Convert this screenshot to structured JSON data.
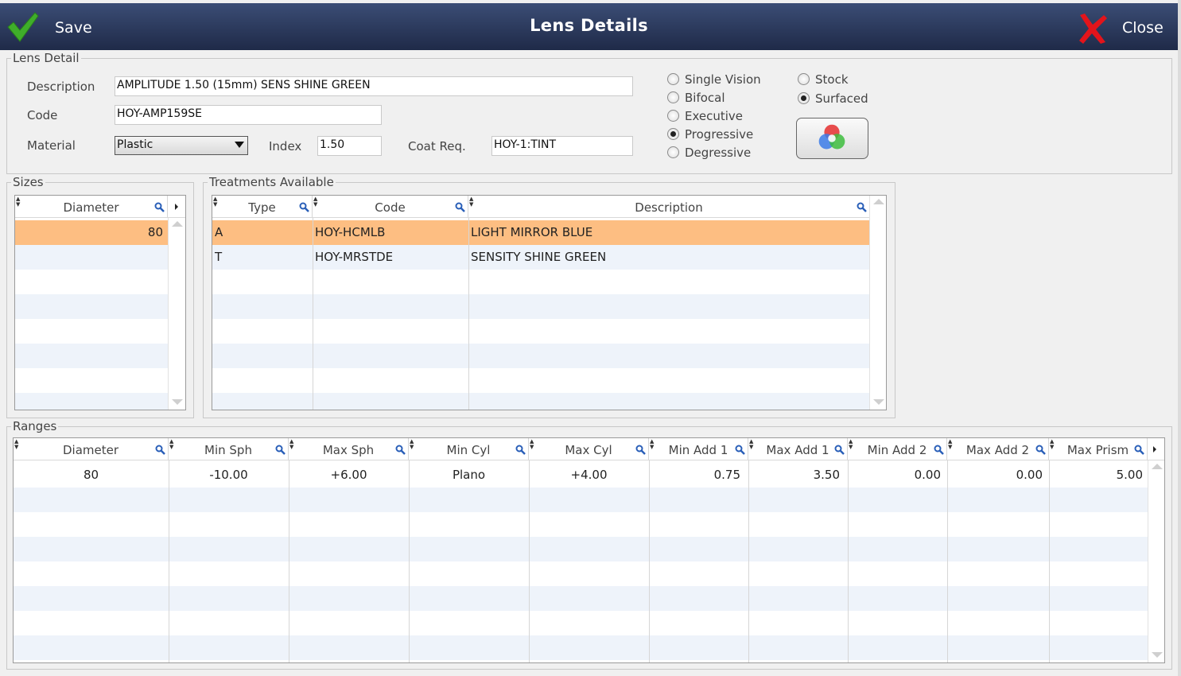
{
  "header": {
    "save_label": "Save",
    "title": "Lens Details",
    "close_label": "Close"
  },
  "lens_detail": {
    "group_title": "Lens Detail",
    "description_label": "Description",
    "description_value": "AMPLITUDE 1.50 (15mm) SENS SHINE GREEN",
    "code_label": "Code",
    "code_value": "HOY-AMP159SE",
    "material_label": "Material",
    "material_value": "Plastic",
    "index_label": "Index",
    "index_value": "1.50",
    "coat_label": "Coat Req.",
    "coat_value": "HOY-1:TINT",
    "vision_types": [
      {
        "label": "Single Vision",
        "selected": false
      },
      {
        "label": "Bifocal",
        "selected": false
      },
      {
        "label": "Executive",
        "selected": false
      },
      {
        "label": "Progressive",
        "selected": true
      },
      {
        "label": "Degressive",
        "selected": false
      }
    ],
    "stock_types": [
      {
        "label": "Stock",
        "selected": false
      },
      {
        "label": "Surfaced",
        "selected": true
      }
    ]
  },
  "sizes": {
    "group_title": "Sizes",
    "columns": [
      "Diameter"
    ],
    "rows": [
      [
        "80"
      ]
    ]
  },
  "treatments": {
    "group_title": "Treatments Available",
    "columns": [
      "Type",
      "Code",
      "Description"
    ],
    "rows": [
      [
        "A",
        "HOY-HCMLB",
        "LIGHT MIRROR BLUE"
      ],
      [
        "T",
        "HOY-MRSTDE",
        "SENSITY SHINE GREEN"
      ]
    ]
  },
  "ranges": {
    "group_title": "Ranges",
    "columns": [
      "Diameter",
      "Min Sph",
      "Max Sph",
      "Min Cyl",
      "Max Cyl",
      "Min Add 1",
      "Max Add 1",
      "Min Add 2",
      "Max Add 2",
      "Max Prism"
    ],
    "rows": [
      [
        "80",
        "-10.00",
        "+6.00",
        "Plano",
        "+4.00",
        "0.75",
        "3.50",
        "0.00",
        "0.00",
        "5.00"
      ]
    ]
  },
  "colors": {
    "header_top": "#3b4d75",
    "header_bottom": "#1f2a48",
    "selected_row": "#fdbe82",
    "alt_row": "#eef3fa"
  },
  "icons": [
    "save-check-icon",
    "close-x-icon",
    "magnifier-icon",
    "color-wheel-icon"
  ]
}
